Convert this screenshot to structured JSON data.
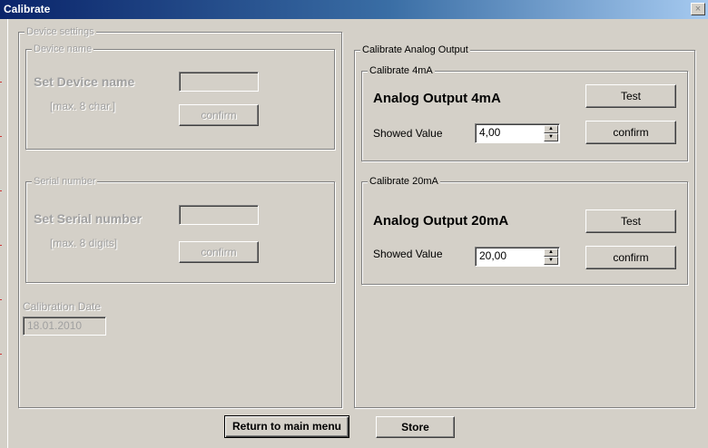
{
  "window": {
    "title": "Calibrate",
    "close_glyph": "×"
  },
  "device_settings": {
    "legend": "Device settings",
    "device_name": {
      "legend": "Device name",
      "label": "Set Device name",
      "hint": "[max. 8 char.]",
      "value": "",
      "confirm_label": "confirm"
    },
    "serial_number": {
      "legend": "Serial number",
      "label": "Set Serial number",
      "hint": "[max. 8 digits]",
      "value": "",
      "confirm_label": "confirm"
    },
    "calibration_date": {
      "label": "Calibration Date",
      "value": "18.01.2010"
    }
  },
  "analog_output": {
    "legend": "Calibrate Analog Output",
    "cal_4ma": {
      "legend": "Calibrate 4mA",
      "title": "Analog Output 4mA",
      "test_label": "Test",
      "showed_value_label": "Showed Value",
      "value": "4,00",
      "confirm_label": "confirm"
    },
    "cal_20ma": {
      "legend": "Calibrate 20mA",
      "title": "Analog Output 20mA",
      "test_label": "Test",
      "showed_value_label": "Showed Value",
      "value": "20,00",
      "confirm_label": "confirm"
    }
  },
  "footer": {
    "return_label": "Return to main menu",
    "store_label": "Store"
  },
  "colors": {
    "dialog_bg": "#d4d0c8",
    "title_gradient_start": "#0a246a",
    "title_gradient_end": "#a6caf0"
  },
  "icons": {
    "spin_up": "spin-up-arrow-icon",
    "spin_down": "spin-down-arrow-icon",
    "close": "close-icon"
  }
}
